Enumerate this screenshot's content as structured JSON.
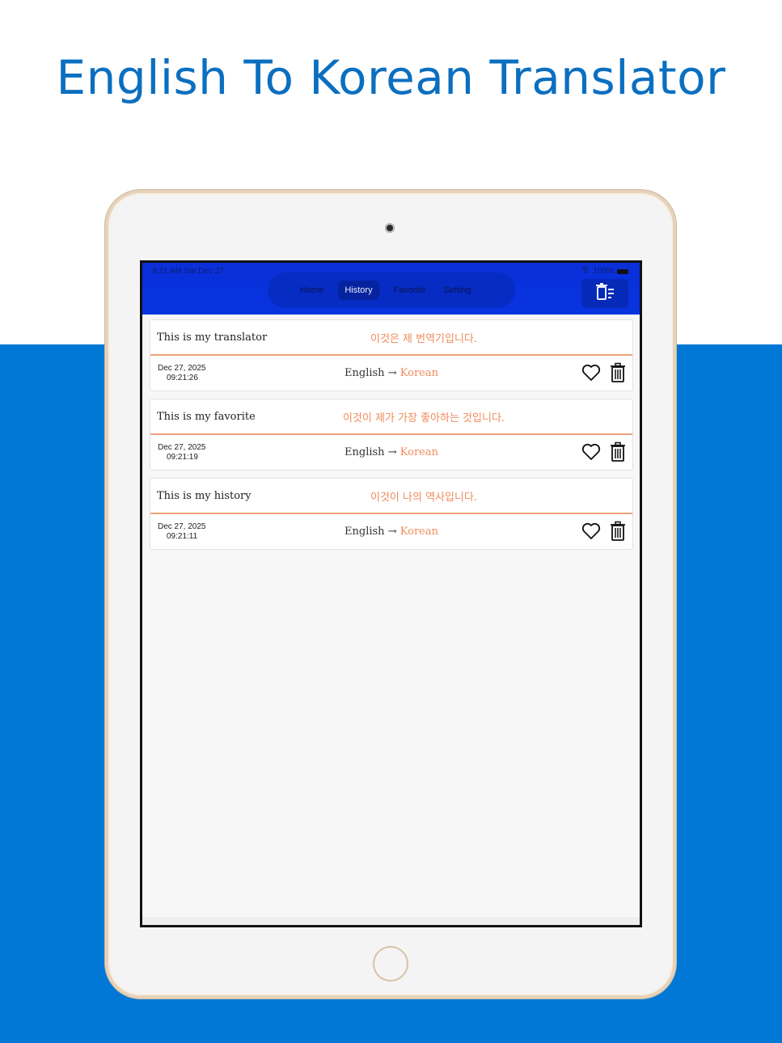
{
  "headline": "English To Korean Translator",
  "status_bar": {
    "time": "9:21 AM   Sat Dec 27",
    "battery": "100%"
  },
  "nav": {
    "tabs": [
      {
        "label": "Home",
        "active": false
      },
      {
        "label": "History",
        "active": true
      },
      {
        "label": "Favorite",
        "active": false
      },
      {
        "label": "Setting",
        "active": false
      }
    ],
    "action_icon": "clear-history-icon"
  },
  "history": [
    {
      "source": "This is my translator",
      "translation": "이것은 제 번역기입니다.",
      "date": "Dec 27, 2025",
      "time": "09:21:26",
      "from_lang": "English",
      "arrow": "→",
      "to_lang": "Korean"
    },
    {
      "source": "This is my favorite",
      "translation": "이것이 제가 가장 좋아하는 것입니다.",
      "date": "Dec 27, 2025",
      "time": "09:21:19",
      "from_lang": "English",
      "arrow": "→",
      "to_lang": "Korean"
    },
    {
      "source": "This is my history",
      "translation": "이것이 나의 역사입니다.",
      "date": "Dec 27, 2025",
      "time": "09:21:11",
      "from_lang": "English",
      "arrow": "→",
      "to_lang": "Korean"
    }
  ],
  "colors": {
    "accent": "#f08a5a",
    "brand_blue": "#0278d6",
    "title_blue": "#0b6fc0",
    "bar_blue": "#0734e0"
  }
}
